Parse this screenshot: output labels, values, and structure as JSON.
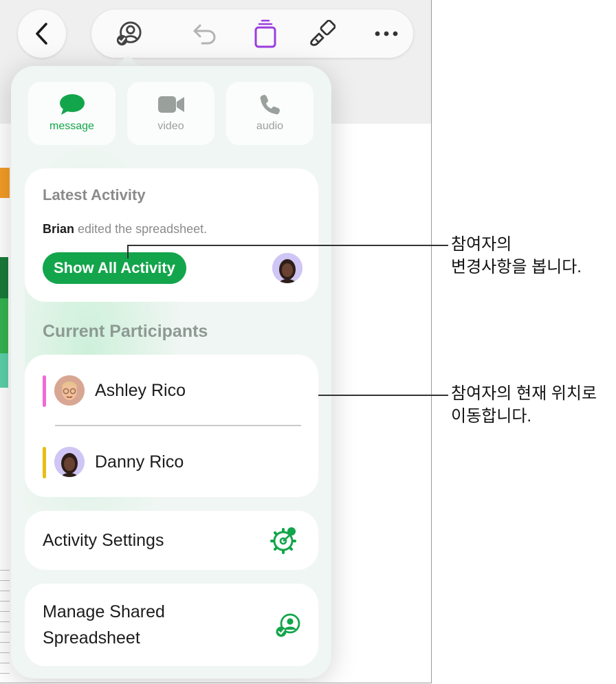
{
  "toolbar": {
    "back_icon": "chevron-left-icon",
    "icons": [
      "collaboration-icon",
      "undo-icon",
      "format-panel-icon",
      "paintbrush-icon",
      "more-icon"
    ]
  },
  "comm_buttons": [
    {
      "label": "message",
      "icon": "message-bubble-icon",
      "color": "#13a54b",
      "active": true
    },
    {
      "label": "video",
      "icon": "video-camera-icon",
      "color": "#9aa09c",
      "active": false
    },
    {
      "label": "audio",
      "icon": "phone-icon",
      "color": "#9aa09c",
      "active": false
    }
  ],
  "latest_activity": {
    "title": "Latest Activity",
    "user": "Brian",
    "text": "edited the spreadsheet.",
    "button": "Show All Activity"
  },
  "participants": {
    "title": "Current Participants",
    "items": [
      {
        "name": "Ashley Rico",
        "color": "#f06ad6"
      },
      {
        "name": "Danny Rico",
        "color": "#e9be13"
      }
    ]
  },
  "activity_settings": {
    "label": "Activity Settings"
  },
  "manage_shared": {
    "line1": "Manage Shared",
    "line2": "Spreadsheet"
  },
  "callouts": [
    {
      "line1": "참여자의",
      "line2": "변경사항을 봅니다."
    },
    {
      "line1": "참여자의 현재 위치로",
      "line2": "이동합니다."
    }
  ],
  "colors": {
    "accent": "#13a54b",
    "secondary_text": "#8b8b8b"
  }
}
